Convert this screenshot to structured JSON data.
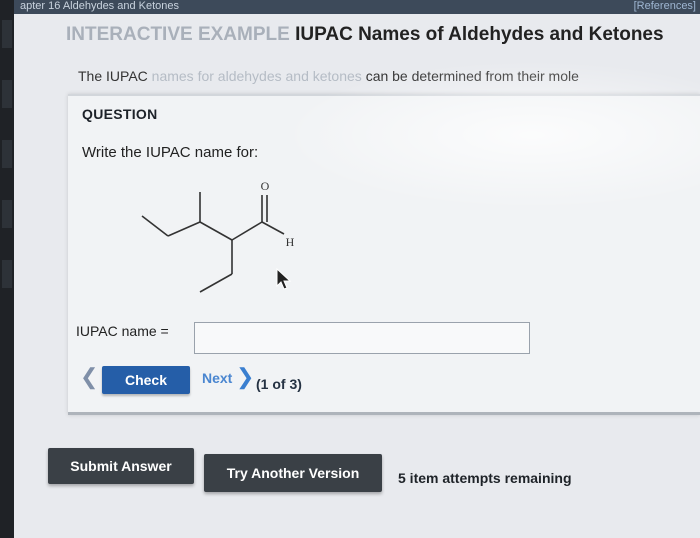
{
  "topbar": {
    "breadcrumb": "apter 16 Aldehydes and Ketones",
    "references": "[References]"
  },
  "header": {
    "prefix": "INTERACTIVE EXAMPLE",
    "title": "IUPAC Names of Aldehydes and Ketones"
  },
  "intro": {
    "lead": "The IUPAC",
    "faded": "names for aldehydes and ketones",
    "tail": "can be determined from their mole"
  },
  "question": {
    "heading": "QUESTION",
    "prompt": "Write the IUPAC name for:",
    "molecule_atoms": {
      "oxygen": "O",
      "hydrogen": "H"
    },
    "answer_label": "IUPAC name =",
    "answer_value": "",
    "check_label": "Check",
    "next_label": "Next",
    "counter": "(1 of 3)"
  },
  "footer": {
    "submit_label": "Submit Answer",
    "try_label": "Try Another Version",
    "attempts_text": "5 item attempts remaining"
  },
  "colors": {
    "check_button": "#255ea8",
    "dark_button": "#3a4046",
    "next_link": "#4a86d0"
  },
  "icons": {
    "prev": "chevron-left-icon",
    "next": "chevron-right-icon",
    "cursor": "mouse-pointer-icon"
  }
}
